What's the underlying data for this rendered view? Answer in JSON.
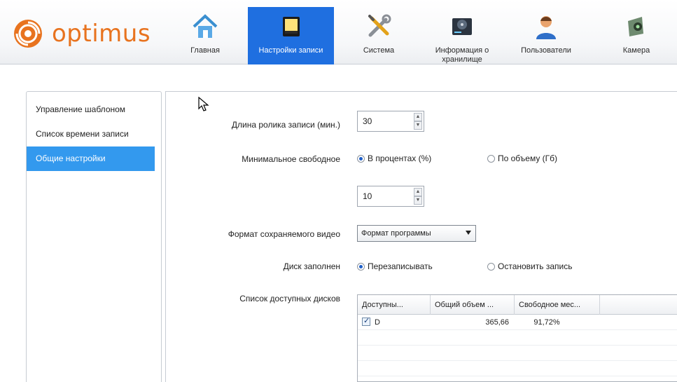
{
  "app": {
    "logo_text": "optimus",
    "brand_color": "#e8731f",
    "accent_color": "#1f6fe0"
  },
  "nav": [
    {
      "label": "Главная",
      "icon": "home-icon"
    },
    {
      "label": "Настройки записи",
      "icon": "recorder-icon",
      "active": true
    },
    {
      "label": "Система",
      "icon": "tools-icon"
    },
    {
      "label": "Информация о хранилище",
      "icon": "hdd-icon"
    },
    {
      "label": "Пользователи",
      "icon": "user-icon"
    },
    {
      "label": "Камера",
      "icon": "camera-icon"
    }
  ],
  "sidebar": {
    "items": [
      {
        "label": "Управление шаблоном"
      },
      {
        "label": "Список времени записи"
      },
      {
        "label": "Общие настройки",
        "selected": true
      }
    ]
  },
  "form": {
    "clip_length_label": "Длина ролика записи (мин.)",
    "clip_length_value": "30",
    "min_free_label": "Минимальное свободное",
    "min_free_percent_label": "В процентах (%)",
    "min_free_volume_label": "По объему (Гб)",
    "min_free_value": "10",
    "video_format_label": "Формат сохраняемого видео",
    "video_format_value": "Формат программы",
    "disk_full_label": "Диск заполнен",
    "disk_full_overwrite_label": "Перезаписывать",
    "disk_full_stop_label": "Остановить запись",
    "disk_list_label": "Список доступных дисков"
  },
  "disk_table": {
    "columns": [
      "Доступны...",
      "Общий объем ...",
      "Свободное мес..."
    ],
    "rows": [
      {
        "name": "D",
        "checked": true,
        "total": "365,66",
        "free": "91,72%"
      }
    ]
  }
}
